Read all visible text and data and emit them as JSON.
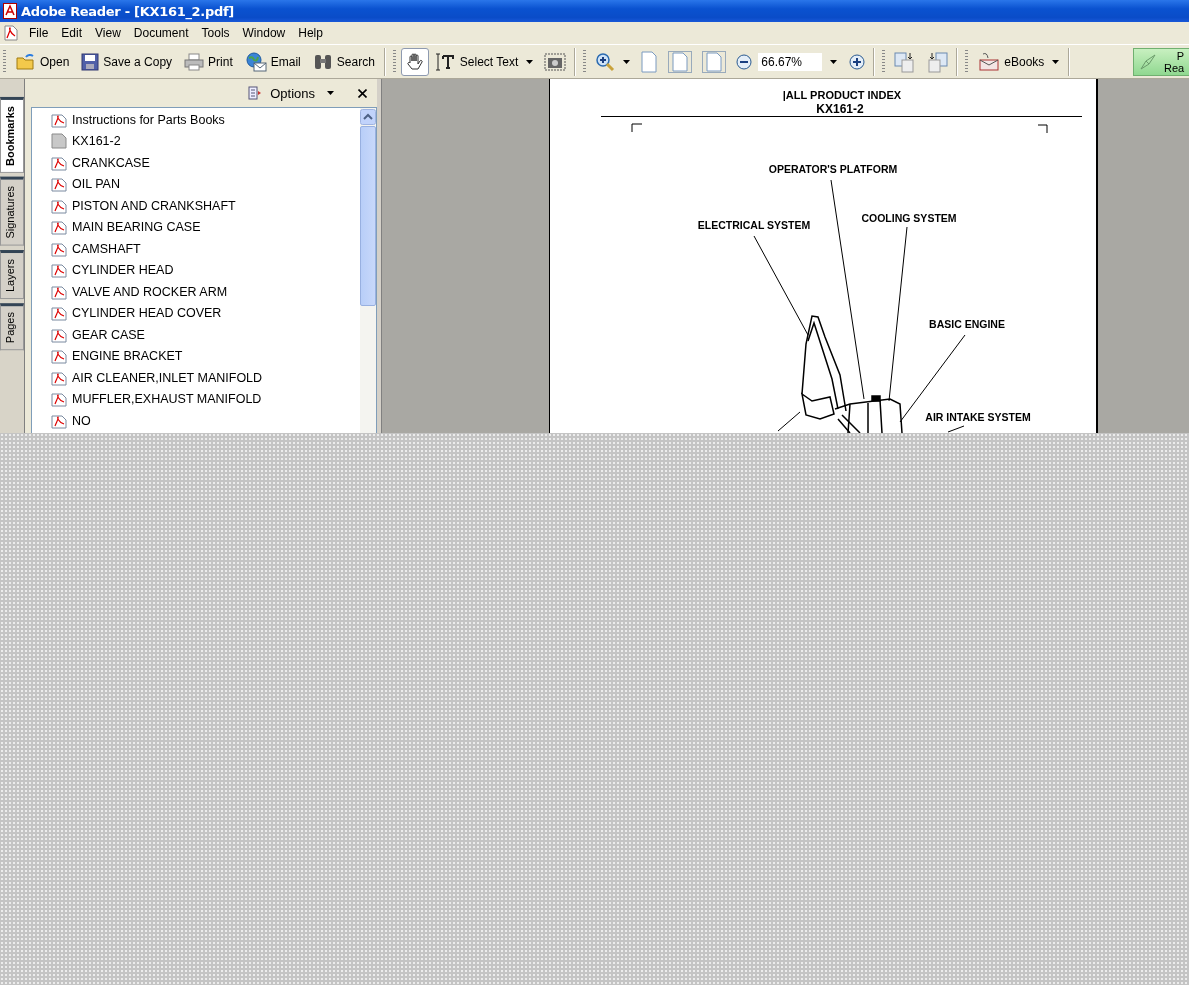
{
  "window": {
    "title": "Adobe Reader - [KX161_2.pdf]"
  },
  "menu": [
    "File",
    "Edit",
    "View",
    "Document",
    "Tools",
    "Window",
    "Help"
  ],
  "toolbar": {
    "open": "Open",
    "save_copy": "Save a Copy",
    "print": "Print",
    "email": "Email",
    "search": "Search",
    "hand_tool": {
      "selected": true
    },
    "select_text": "Select Text",
    "zoom": "66.67%",
    "ebooks": "eBooks",
    "promo": [
      "P",
      "Rea"
    ]
  },
  "sidebar": {
    "tabs": [
      {
        "label": "Bookmarks",
        "selected": true
      },
      {
        "label": "Signatures",
        "selected": false
      },
      {
        "label": "Layers",
        "selected": false
      },
      {
        "label": "Pages",
        "selected": false
      }
    ],
    "options": "Options",
    "bookmarks": [
      {
        "label": "Instructions for Parts Books",
        "kind": "pdf"
      },
      {
        "label": "KX161-2",
        "kind": "page"
      },
      {
        "label": "CRANKCASE",
        "kind": "pdf"
      },
      {
        "label": "OIL PAN",
        "kind": "pdf"
      },
      {
        "label": "PISTON AND CRANKSHAFT",
        "kind": "pdf"
      },
      {
        "label": "MAIN BEARING CASE",
        "kind": "pdf"
      },
      {
        "label": "CAMSHAFT",
        "kind": "pdf"
      },
      {
        "label": "CYLINDER HEAD",
        "kind": "pdf"
      },
      {
        "label": "VALVE AND ROCKER ARM",
        "kind": "pdf"
      },
      {
        "label": "CYLINDER HEAD COVER",
        "kind": "pdf"
      },
      {
        "label": "GEAR CASE",
        "kind": "pdf"
      },
      {
        "label": "ENGINE BRACKET",
        "kind": "pdf"
      },
      {
        "label": "AIR CLEANER,INLET MANIFOLD",
        "kind": "pdf"
      },
      {
        "label": "MUFFLER,EXHAUST MANIFOLD",
        "kind": "pdf"
      },
      {
        "label": "NO",
        "kind": "pdf"
      }
    ]
  },
  "document": {
    "heading": "|ALL PRODUCT INDEX",
    "model": "KX161-2",
    "labels": [
      "OPERATOR'S PLATFORM",
      "ELECTRICAL SYSTEM",
      "COOLING SYSTEM",
      "BASIC ENGINE",
      "AIR INTAKE SYSTEM"
    ]
  }
}
